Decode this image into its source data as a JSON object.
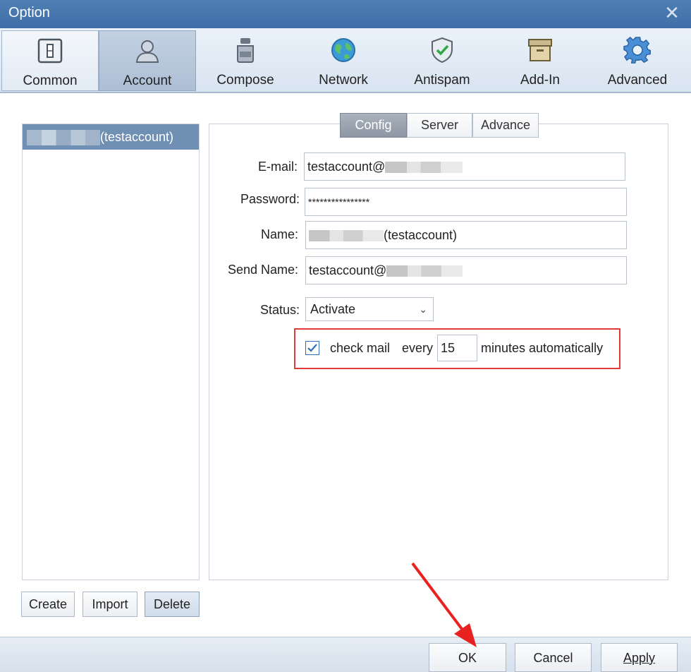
{
  "window": {
    "title": "Option",
    "close_glyph": "✕"
  },
  "toolbar": {
    "items": [
      {
        "label": "Common",
        "icon": "common-icon"
      },
      {
        "label": "Account",
        "icon": "account-icon"
      },
      {
        "label": "Compose",
        "icon": "compose-icon"
      },
      {
        "label": "Network",
        "icon": "network-icon"
      },
      {
        "label": "Antispam",
        "icon": "antispam-icon"
      },
      {
        "label": "Add-In",
        "icon": "add-in-icon"
      },
      {
        "label": "Advanced",
        "icon": "advanced-icon"
      }
    ],
    "selected": "Account"
  },
  "accounts": {
    "items": [
      {
        "label": "(testaccount)"
      }
    ],
    "selected_index": 0
  },
  "account_buttons": {
    "create": "Create",
    "import": "Import",
    "delete": "Delete"
  },
  "tabs": {
    "items": [
      "Config",
      "Server",
      "Advance"
    ],
    "active": "Config"
  },
  "form": {
    "email_label": "E-mail:",
    "email_value": "testaccount@",
    "password_label": "Password:",
    "password_value": "****************",
    "name_label": "Name:",
    "name_value": "(testaccount)",
    "send_name_label": "Send Name:",
    "send_name_value": "testaccount@",
    "status_label": "Status:",
    "status_value": "Activate",
    "check_mail_checked": true,
    "check_mail_label": "check mail",
    "every_label": "every",
    "minutes_value": "15",
    "minutes_suffix": "minutes automatically"
  },
  "dialog_buttons": {
    "ok": "OK",
    "cancel": "Cancel",
    "apply": "Apply"
  },
  "colors": {
    "titlebar": "#3e6ea6",
    "selection": "#6f8fb3",
    "highlight_box": "#e03a3a",
    "arrow": "#e8231f"
  }
}
